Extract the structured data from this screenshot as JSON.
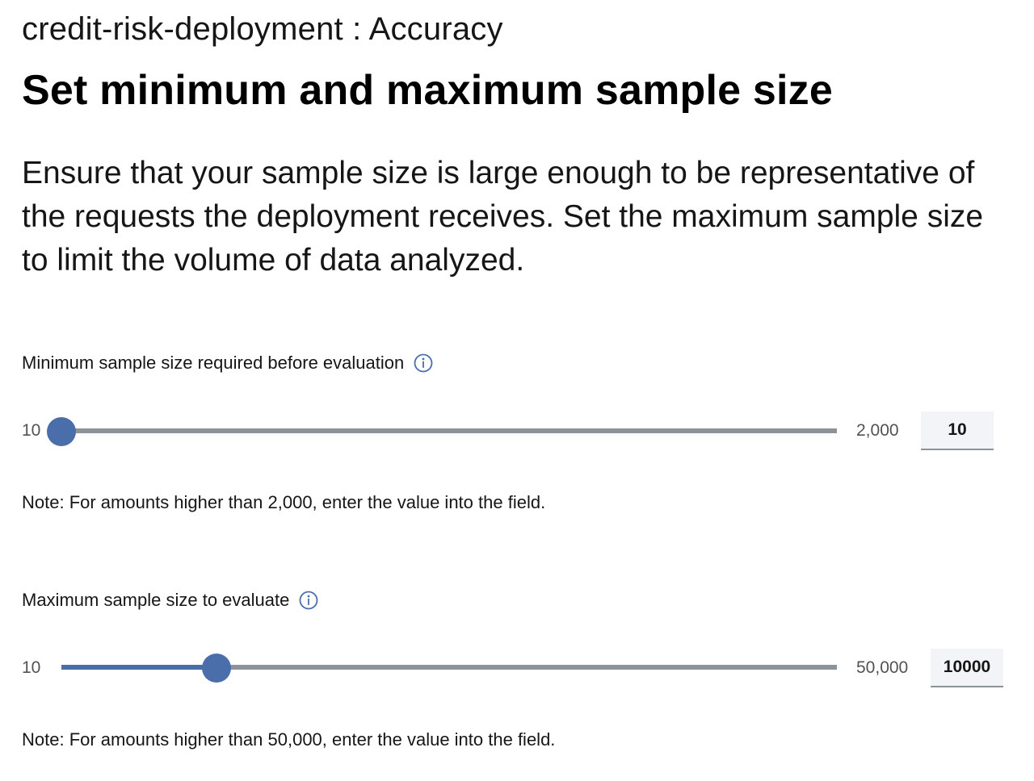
{
  "header": {
    "breadcrumb": "credit-risk-deployment : Accuracy",
    "title": "Set minimum and maximum sample size"
  },
  "description": "Ensure that your sample size is large enough to be representative of the requests the deployment receives. Set the maximum sample size to limit the volume of data analyzed.",
  "min_sample": {
    "label": "Minimum sample size required before evaluation",
    "info_icon": "info-icon",
    "range_min_label": "10",
    "range_max_label": "2,000",
    "range_min": 10,
    "range_max": 2000,
    "value": 10,
    "input_value": "10",
    "note": "Note: For amounts higher than 2,000, enter the value into the field."
  },
  "max_sample": {
    "label": "Maximum sample size to evaluate",
    "info_icon": "info-icon",
    "range_min_label": "10",
    "range_max_label": "50,000",
    "range_min": 10,
    "range_max": 50000,
    "value": 10000,
    "input_value": "10000",
    "note": "Note: For amounts higher than 50,000, enter the value into the field."
  },
  "colors": {
    "accent": "#4a6ea9",
    "track": "#8d9499",
    "input_bg": "#f2f4f8"
  }
}
